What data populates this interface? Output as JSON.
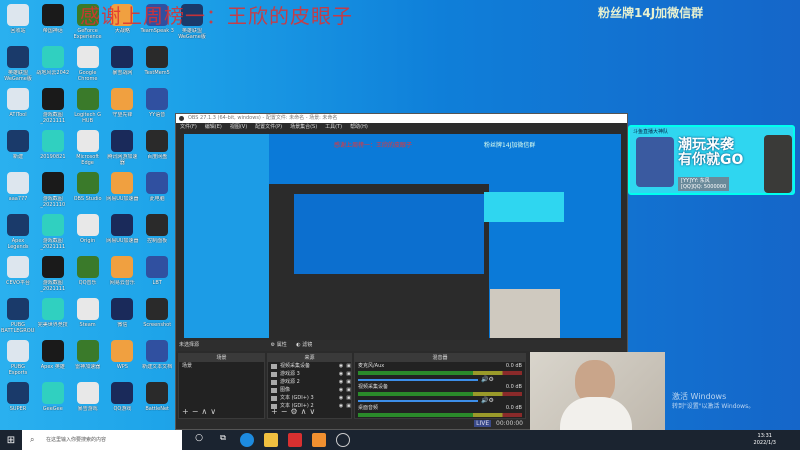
{
  "overlay": {
    "watermark": "感谢上周榜一：王欣的皮眼子",
    "fans_badge": "粉丝牌14J加微信群"
  },
  "desktop_icons": [
    [
      "回收站",
      "帝国神话",
      "GeForce Experience",
      "大战略",
      "TeamSpeak 3",
      "英雄联盟WeGame版"
    ],
    [
      "英雄联盟WeGame版",
      "战地风云2042",
      "Google Chrome",
      "暴雪战网",
      "TestMem5"
    ],
    [
      "ATITool",
      "游戏截图_2021111",
      "Logitech G HUB",
      "守望先锋",
      "YY语音"
    ],
    [
      "新建",
      "20190821",
      "Microsoft Edge",
      "腾讯网游加速器",
      "百度网盘"
    ],
    [
      "aaa777",
      "游戏截图_2021110",
      "OBS Studio",
      "网易UU加速器",
      "此电脑"
    ],
    [
      "Apex Legends",
      "游戏截图_2021111",
      "Origin",
      "网易UU加速器",
      "控制面板"
    ],
    [
      "CEVO平台",
      "游戏截图_2021111",
      "QQ音乐",
      "网易云音乐",
      "LBT"
    ],
    [
      "PUBG BATTLEGROUNDS",
      "完美世界竞技",
      "Steam",
      "微信",
      "Screenshot"
    ],
    [
      "PUBG Esports",
      "Apex 英雄",
      "雷神加速器",
      "WPS",
      "新建文本文档"
    ],
    [
      "SUPER",
      "GeeGee",
      "暴雪游戏",
      "QQ游戏",
      "BattleNet"
    ]
  ],
  "icon_colors": [
    "#dde6ee",
    "#1a1a1a",
    "#3a7a2a",
    "#f0a040",
    "#3050a0",
    "#1a3a6a",
    "#30d0c0",
    "#e8e8e8",
    "#1a2a5a",
    "#2a2a2a"
  ],
  "obs": {
    "title": "OBS 27.1.3 (64-bit, windows) - 配置文件: 未命名 - 场景: 未命名",
    "menu": [
      "文件(F)",
      "编辑(E)",
      "视图(V)",
      "配置文件(P)",
      "场景集合(S)",
      "工具(T)",
      "帮助(H)"
    ],
    "no_source": "未选择源",
    "properties": "属性",
    "filters": "滤镜",
    "scenes_title": "场景",
    "scenes": [
      "场景"
    ],
    "sources_title": "来源",
    "sources": [
      "视频采集设备",
      "游戏源 3",
      "游戏源 2",
      "图像",
      "文本 (GDI+) 3",
      "文本 (GDI+) 2"
    ],
    "mixer_title": "混音器",
    "mixer": [
      {
        "name": "麦克风/Aux",
        "db": "0.0 dB"
      },
      {
        "name": "视频采集设备",
        "db": "0.0 dB"
      },
      {
        "name": "桌面音频",
        "db": "0.0 dB"
      }
    ],
    "live": "LIVE",
    "time": "00:00:00"
  },
  "banner": {
    "header": "斗鱼直播大神队",
    "line1": "潮玩来袭",
    "line2": "有你就GO",
    "yy": "[YY]YY: 东风",
    "qq": "[QQ]QQ: 5000000"
  },
  "activation": {
    "line1": "激活 Windows",
    "line2": "转到\"设置\"以激活 Windows。"
  },
  "taskbar": {
    "search_placeholder": "在这里输入你要搜索的内容",
    "time": "13:31",
    "date": "2022/1/3"
  }
}
